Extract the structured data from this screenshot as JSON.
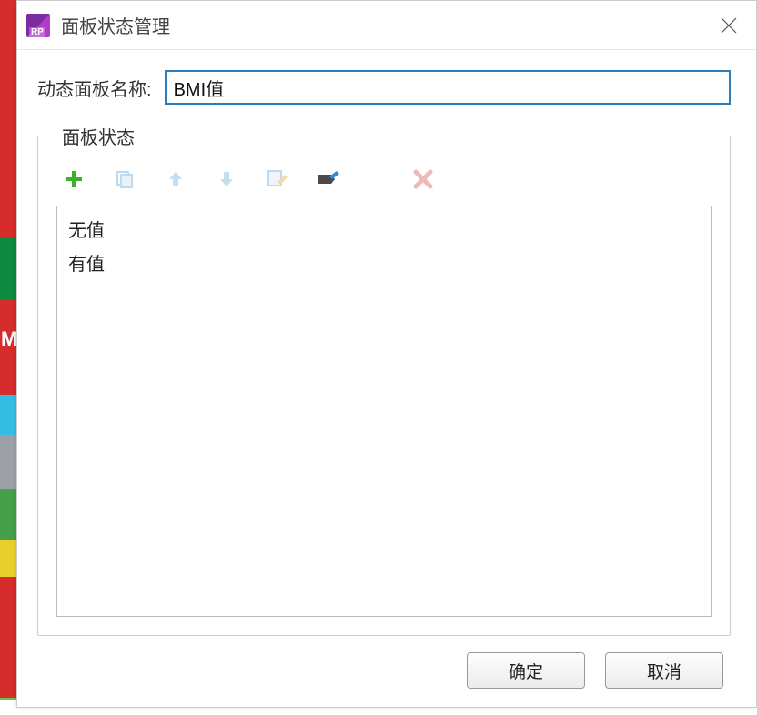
{
  "window": {
    "title": "面板状态管理"
  },
  "form": {
    "name_label": "动态面板名称:",
    "name_value": "BMI值"
  },
  "fieldset": {
    "legend": "面板状态"
  },
  "toolbar": {
    "add": {
      "name": "add-icon"
    },
    "duplicate": {
      "name": "duplicate-icon"
    },
    "move_up": {
      "name": "arrow-up-icon"
    },
    "move_down": {
      "name": "arrow-down-icon"
    },
    "edit": {
      "name": "edit-icon"
    },
    "rename": {
      "name": "rename-icon"
    },
    "delete": {
      "name": "delete-icon"
    }
  },
  "states": [
    "无值",
    "有值"
  ],
  "buttons": {
    "ok": "确定",
    "cancel": "取消"
  },
  "background": {
    "partial_label": "M"
  }
}
